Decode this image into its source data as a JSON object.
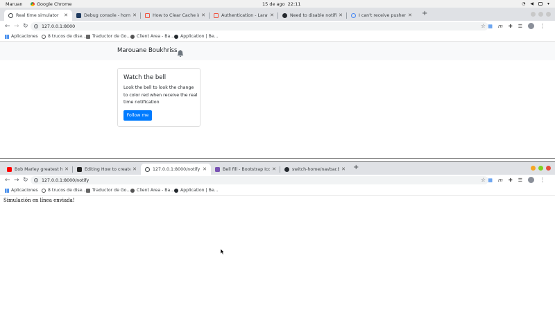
{
  "system_bar": {
    "user": "Maruan",
    "app": "Google Chrome",
    "date": "15 de ago",
    "time": "22:11"
  },
  "window1": {
    "tabs": [
      {
        "label": "Real time simulator",
        "color": "#3c4043",
        "active": true
      },
      {
        "label": "Debug console - home-sw...",
        "color": "#1e3a5f",
        "active": false
      },
      {
        "label": "How to Clear Cache in Lar...",
        "color": "#f05340",
        "active": false
      },
      {
        "label": "Authentication - Laravel - T",
        "color": "#f05340",
        "active": false
      },
      {
        "label": "Need to disable notification",
        "color": "#24292e",
        "active": false
      },
      {
        "label": "I can't receive pusher mess",
        "color": "#4285f4",
        "active": false
      }
    ],
    "address": "127.0.0.1:8000",
    "bookmarks": [
      "Aplicaciones",
      "8 trucos de dise...",
      "Traductor de Go...",
      "Client Area - Ba...",
      "Application | Be..."
    ],
    "app_page": {
      "brand": "Marouane Boukhriss",
      "card_title": "Watch the bell",
      "card_text": "Look the bell to look the change to color red when receive the real time notification",
      "button_label": "Follow me"
    }
  },
  "window2": {
    "tabs": [
      {
        "label": "Bob Marley greatest hits",
        "color": "#ff0000",
        "active": false
      },
      {
        "label": "Editing How to create real ti",
        "color": "#222222",
        "active": false
      },
      {
        "label": "127.0.0.1:8000/notify",
        "color": "#3c4043",
        "active": true
      },
      {
        "label": "Bell fill - Bootstrap Icons",
        "color": "#7952b3",
        "active": false
      },
      {
        "label": "switch-home/navbar.blade.p",
        "color": "#24292e",
        "active": false
      }
    ],
    "address": "127.0.0.1:8000/notify",
    "bookmarks": [
      "Aplicaciones",
      "8 trucos de dise...",
      "Traductor de Go...",
      "Client Area - Ba...",
      "Application | Be..."
    ],
    "page_message": "Simulación en línea enviada!"
  },
  "icons": {
    "bell": "bell-icon",
    "back": "arrow-left-icon",
    "forward": "arrow-right-icon",
    "reload": "reload-icon",
    "star": "star-icon",
    "extensions": "puzzle-icon",
    "menu": "kebab-menu-icon"
  },
  "colors": {
    "primary_button": "#007bff",
    "tabstrip": "#dfe1e5",
    "navbar_bg": "#f8f9fa"
  }
}
